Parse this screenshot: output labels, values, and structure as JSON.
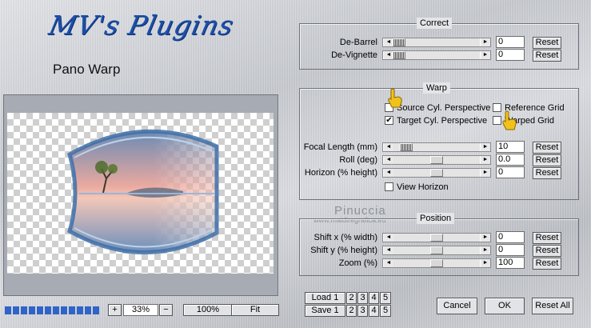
{
  "header": {
    "logo_text": "MV's Plugins",
    "subtitle": "Pano Warp"
  },
  "watermark": {
    "line1": "Pinuccia",
    "line2": "www.maidiregrafica.eu"
  },
  "correct": {
    "title": "Correct",
    "rows": [
      {
        "label": "De-Barrel",
        "value": "0",
        "reset": "Reset",
        "position": 0.0
      },
      {
        "label": "De-Vignette",
        "value": "0",
        "reset": "Reset",
        "position": 0.0
      }
    ]
  },
  "warp": {
    "title": "Warp",
    "checks": {
      "source_cyl": {
        "label": "Source Cyl. Perspective",
        "checked": false
      },
      "reference_grid": {
        "label": "Reference Grid",
        "checked": false
      },
      "target_cyl": {
        "label": "Target Cyl. Perspective",
        "checked": true
      },
      "warped_grid": {
        "label": "Warped Grid",
        "checked": false
      },
      "view_horizon": {
        "label": "View Horizon",
        "checked": false
      }
    },
    "rows": [
      {
        "label": "Focal Length (mm)",
        "value": "10",
        "reset": "Reset",
        "position": 0.1
      },
      {
        "label": "Roll (deg)",
        "value": "0.0",
        "reset": "Reset",
        "position": 0.5
      },
      {
        "label": "Horizon (% height)",
        "value": "0",
        "reset": "Reset",
        "position": 0.5
      }
    ]
  },
  "position": {
    "title": "Position",
    "rows": [
      {
        "label": "Shift x (% width)",
        "value": "0",
        "reset": "Reset",
        "position": 0.5
      },
      {
        "label": "Shift y (% height)",
        "value": "0",
        "reset": "Reset",
        "position": 0.5
      },
      {
        "label": "Zoom (%)",
        "value": "100",
        "reset": "Reset",
        "position": 0.5
      }
    ]
  },
  "zoom_bar": {
    "plus": "+",
    "value": "33%",
    "minus": "−",
    "hundred": "100%",
    "fit": "Fit"
  },
  "presets": {
    "load_label": "Load 1",
    "save_label": "Save 1",
    "slots": [
      "2",
      "3",
      "4",
      "5"
    ]
  },
  "actions": {
    "cancel": "Cancel",
    "ok": "OK",
    "reset_all": "Reset All"
  },
  "colors": {
    "logo": "#1d4fa8",
    "progress": "#2f64c8",
    "hand_cursor": "#f2c21b"
  },
  "icons": {
    "hand_pointer": "hand-pointer-icon",
    "arrow_left": "◄",
    "arrow_right": "►"
  }
}
